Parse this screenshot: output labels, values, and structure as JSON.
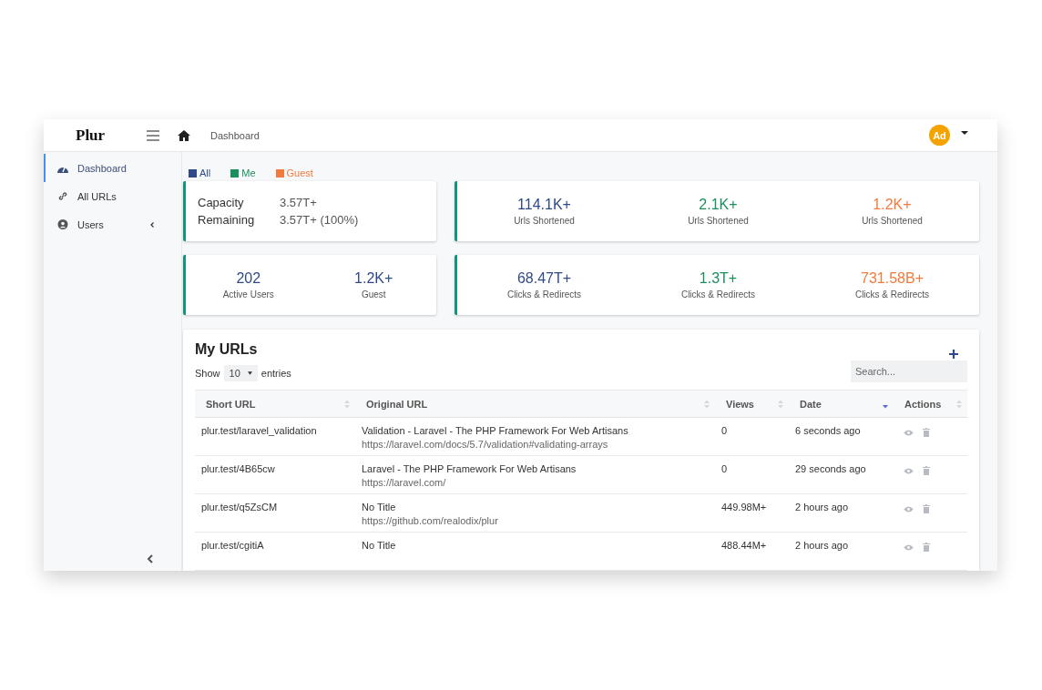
{
  "brand": "Plur",
  "breadcrumb": "Dashboard",
  "user": {
    "initials": "Ad"
  },
  "sidebar": {
    "items": [
      {
        "label": "Dashboard",
        "selected": true,
        "expandable": false
      },
      {
        "label": "All URLs",
        "selected": false,
        "expandable": false
      },
      {
        "label": "Users",
        "selected": false,
        "expandable": true
      }
    ]
  },
  "legend": [
    {
      "label": "All",
      "color": "#2f4a8a"
    },
    {
      "label": "Me",
      "color": "#1a8f5c"
    },
    {
      "label": "Guest",
      "color": "#f27a3d"
    }
  ],
  "capacity": [
    {
      "label": "Capacity",
      "value": "3.57T+"
    },
    {
      "label": "Remaining",
      "value": "3.57T+ (100%)"
    }
  ],
  "users_stats": [
    {
      "value": "202",
      "label": "Active Users",
      "color": "#2f4a8a"
    },
    {
      "value": "1.2K+",
      "label": "Guest",
      "color": "#2f4a8a"
    }
  ],
  "url_stats": [
    {
      "value": "114.1K+",
      "label": "Urls Shortened",
      "color": "#2f4a8a"
    },
    {
      "value": "2.1K+",
      "label": "Urls Shortened",
      "color": "#1a8f5c"
    },
    {
      "value": "1.2K+",
      "label": "Urls Shortened",
      "color": "#f27a3d"
    }
  ],
  "click_stats": [
    {
      "value": "68.47T+",
      "label": "Clicks & Redirects",
      "color": "#2f4a8a"
    },
    {
      "value": "1.3T+",
      "label": "Clicks & Redirects",
      "color": "#1a8f5c"
    },
    {
      "value": "731.58B+",
      "label": "Clicks & Redirects",
      "color": "#f27a3d"
    }
  ],
  "table": {
    "title": "My URLs",
    "show_label": "Show",
    "page_size": "10",
    "entries_label": "entries",
    "search": {
      "placeholder": "Search..."
    },
    "columns": [
      {
        "label": "Short URL",
        "sorted": false
      },
      {
        "label": "Original URL",
        "sorted": false
      },
      {
        "label": "Views",
        "sorted": false
      },
      {
        "label": "Date",
        "sorted": true
      },
      {
        "label": "Actions",
        "sorted": false
      }
    ],
    "rows": [
      {
        "short_url": "plur.test/laravel_validation",
        "title": "Validation - Laravel - The PHP Framework For Web Artisans",
        "url": "https://laravel.com/docs/5.7/validation#validating-arrays",
        "views": "0",
        "date": "6 seconds ago"
      },
      {
        "short_url": "plur.test/4B65cw",
        "title": "Laravel - The PHP Framework For Web Artisans",
        "url": "https://laravel.com/",
        "views": "0",
        "date": "29 seconds ago"
      },
      {
        "short_url": "plur.test/q5ZsCM",
        "title": "No Title",
        "url": "https://github.com/realodix/plur",
        "views": "449.98M+",
        "date": "2 hours ago"
      },
      {
        "short_url": "plur.test/cgitiA",
        "title": "No Title",
        "views": "488.44M+",
        "date": "2 hours ago"
      }
    ]
  }
}
